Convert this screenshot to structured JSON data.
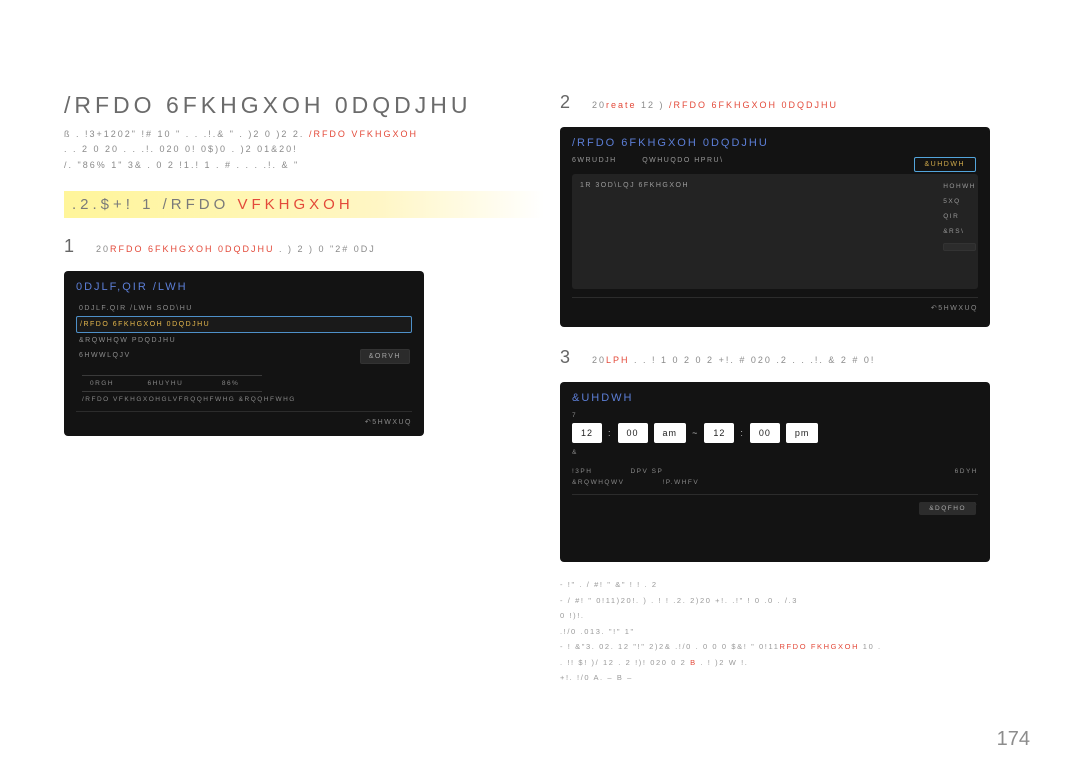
{
  "title": "/RFDO 6FKHGXOH 0DQDJHU",
  "intro": {
    "line1": "ß .  !3+1202\"  !#   10 \" . . .!.&  \" .  )2   0 )2 2.",
    "line1_red": "/RFDO VFKHGXOH",
    "line2": ". .   2      0     20    . . .!.   020  0! 0$)0   .   )2     01&20!",
    "line3": "/.      \"86% 1\" 3&  .  0 2    !1.! 1    .  #  . . . .!. &  \""
  },
  "section": {
    "label": ".2.$+! 1   /RFDO ",
    "label_red": "VFKHGXOH"
  },
  "step1": {
    "num": "1",
    "text_prefix": "20",
    "text_red": "RFDO 6FKHGXOH 0DQDJHU",
    "text_suffix": " .  ) 2       )     0 \"2#  0DJ"
  },
  "step2": {
    "num": "2",
    "text_prefix": "20",
    "text_red": "reate",
    "text_mid": " 12          )  ",
    "text_red2": "/RFDO 6FKHGXOH 0DQDJHU"
  },
  "step3": {
    "num": "3",
    "text_prefix": "20",
    "text_red": "LPH",
    "text_suffix": " .   . ! 1 0 2 0  2    +!.   #    020   .2    . . .!.  &    2 #  0!"
  },
  "card1": {
    "title": "0DJLF,QIR /LWH",
    "items": [
      "0DJLF.QIR /LWH SOD\\HU",
      "/RFDO 6FKHGXOH 0DQDJHU",
      "&RQWHQW PDQDJHU",
      "6HWWLQJV"
    ],
    "close": "&ORVH",
    "table": {
      "h1": "0RGH",
      "h2": "6HUYHU",
      "h3": "86%"
    },
    "caption": "/RFDO VFKHGXOHGLVFRQQHFWHG &RQQHFWHG",
    "return": "5HWXUQ"
  },
  "card2": {
    "title": "/RFDO 6FKHGXOH 0DQDJHU",
    "tabs": [
      "6WRUDJH",
      "QWHUQDO  HPRU\\"
    ],
    "create": "&UHDWH",
    "inner": "1R 3OD\\LQJ 6FKHGXOH",
    "side": [
      "HOHWH",
      "5XQ",
      "QIR",
      "&RS\\"
    ],
    "return": "5HWXUQ"
  },
  "card3": {
    "title": "&UHDWH",
    "time": {
      "h1": "12",
      "m1": "00",
      "p1": "am",
      "tilde": "~",
      "h2": "12",
      "m2": "00",
      "p2": "pm"
    },
    "rowA": [
      "!3PH",
      "DPV   SP"
    ],
    "rowB": [
      "&RQWHQWV",
      "!P.WHFV"
    ],
    "save": "6DYH",
    "cancel": "&DQFHO",
    "return": "5HWXUQ"
  },
  "notes": {
    "l1": "-   !\"   . /   #!    \"   &\"    ! !   . 2",
    "l2": "-    /   #!    \"   0!11)20!.   )   .  ! !    .2. 2)20   +!.   .!\"  !  0   .0  . /.3",
    "l3": "  0  !)!.",
    "l4": "  .!/0   .013.   \"!\"  1\"",
    "l5": "- ! &\"3.  02.  12    \"!\"  2)2&  .!/0   .  0    0 0 $&!     \"  0!11",
    "l5_red": "RFDO FKHGXOH",
    "l5_suf": " 10  .",
    "l6": "  . !!    $!    )/ 12   . 2  !)! 020 0  2",
    "l6mid": "B",
    "l6_suf": " .  !   )2  W   !.",
    "l7": "  +!. !/0 A.                    –   B                    –"
  },
  "page": "174"
}
